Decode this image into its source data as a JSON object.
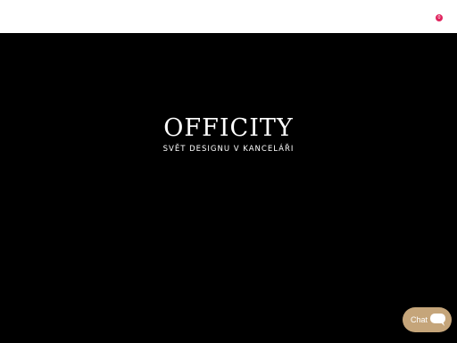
{
  "header": {
    "cart_count": "0",
    "cart_badge_color": "#e0245e"
  },
  "hero": {
    "brand_title": "OFFICITY",
    "brand_subtitle": "SVĚT DESIGNU V KANCELÁŘI",
    "background_color": "#000000"
  },
  "chat": {
    "label": "Chat",
    "icon": "chat-bubble-icon",
    "button_color": "#c5a57a"
  }
}
